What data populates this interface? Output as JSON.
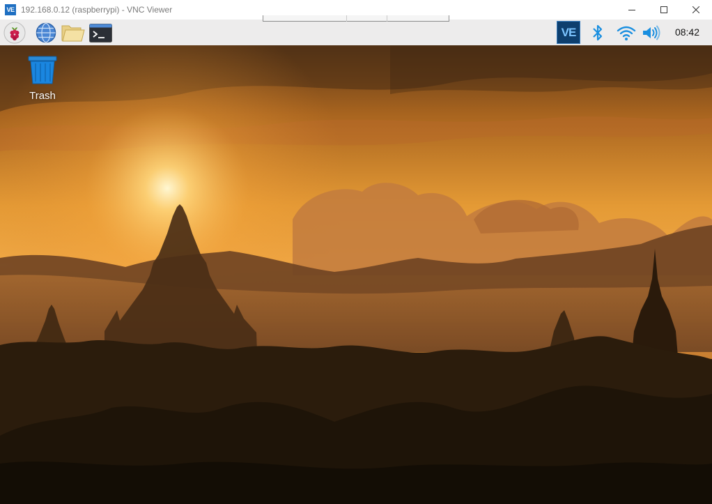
{
  "window": {
    "app_icon_text": "VE",
    "title": "192.168.0.12 (raspberrypi) - VNC Viewer"
  },
  "window_controls": [
    "minimize",
    "maximize",
    "close"
  ],
  "taskbar": {
    "launchers": [
      "raspberry-menu-icon",
      "web-browser-icon",
      "file-manager-icon",
      "terminal-icon"
    ],
    "tray": [
      "vnc-server-icon",
      "bluetooth-icon",
      "wifi-icon",
      "volume-icon"
    ],
    "clock": "08:42",
    "vnc_icon_text": "VE"
  },
  "desktop": {
    "icons": [
      {
        "label": "Trash",
        "icon": "trash-icon"
      }
    ]
  },
  "colors": {
    "accent": "#1e6fc2",
    "tray_blue": "#1a8fe0",
    "vnc_tray_bg": "#0e3f6e"
  }
}
